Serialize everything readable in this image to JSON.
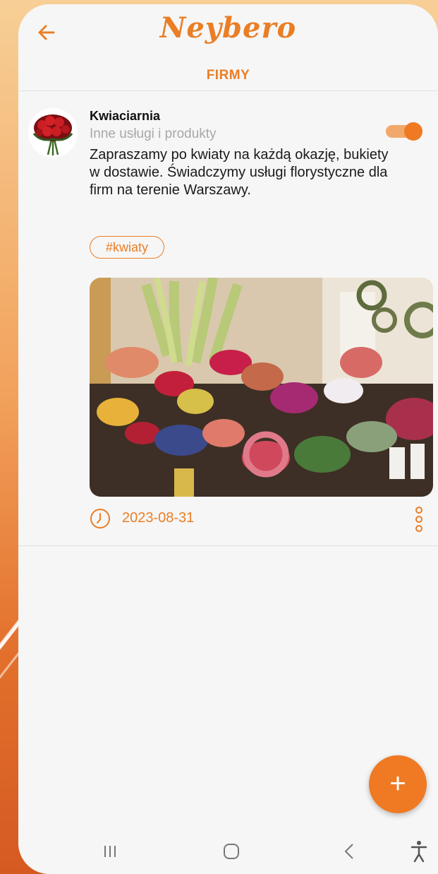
{
  "app": {
    "logo_text": "Neybero",
    "section_title": "FIRMY"
  },
  "icons": {
    "back": "arrow-left-icon",
    "clock": "clock-icon",
    "more": "vertical-dots-icon",
    "fab": "plus-icon",
    "nav_recents": "recents-icon",
    "nav_home": "home-icon",
    "nav_back": "chevron-left-icon",
    "nav_accessibility": "accessibility-icon"
  },
  "colors": {
    "accent": "#ea7e25",
    "toggle_track": "#f2a86a",
    "text": "#1a1a1a",
    "muted": "#a8a8a8"
  },
  "post": {
    "title": "Kwiaciarnia",
    "category": "Inne usługi i produkty",
    "body": "Zapraszamy po kwiaty na każdą okazję, bukiety w dostawie. Świadczymy usługi florystyczne dla firm na terenie Warszawy.",
    "tag": "#kwiaty",
    "date": "2023-08-31",
    "toggle_on": true
  },
  "fab": {
    "label": "+"
  }
}
